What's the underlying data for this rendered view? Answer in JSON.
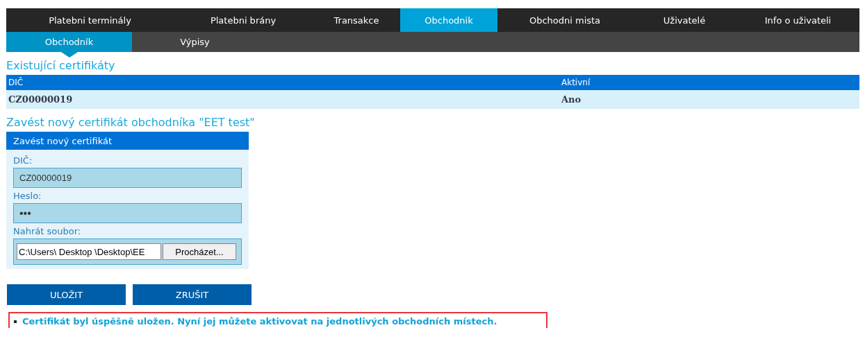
{
  "main_nav": [
    {
      "label": "Platebni terminály",
      "selected": false
    },
    {
      "label": "Platebni brány",
      "selected": false
    },
    {
      "label": "Transakce",
      "selected": false
    },
    {
      "label": "Obchodnik",
      "selected": true
    },
    {
      "label": "Obchodni mista",
      "selected": false
    },
    {
      "label": "Uživatelé",
      "selected": false
    },
    {
      "label": "Info o uživateli",
      "selected": false
    }
  ],
  "sub_nav": [
    {
      "label": "Obchodník",
      "selected": true
    },
    {
      "label": "Výpisy",
      "selected": false
    }
  ],
  "certificates": {
    "title": "Existující certifikáty",
    "columns": [
      "DIČ",
      "Aktivní"
    ],
    "rows": [
      [
        "CZ00000019",
        "Ano"
      ]
    ]
  },
  "new_certificate": {
    "title": "Zavést nový certifikát obchodníka \"EET test\"",
    "panel_title": "Zavést nový certifikát",
    "fields": [
      {
        "kind": "text",
        "label": "DIČ:",
        "value": "CZ00000019"
      },
      {
        "kind": "password",
        "label": "Heslo:",
        "value": "•••"
      },
      {
        "kind": "file",
        "label": "Nahrát soubor:",
        "value": "C:\\Users\\ Desktop \\Desktop\\EE",
        "button": "Procházet..."
      }
    ]
  },
  "buttons": [
    "ULOŽIT",
    "ZRUŠIT"
  ],
  "messages": [
    "Certifikát byl úspěšně uložen. Nyní jej můžete aktivovat na jednotlivých obchodních místech."
  ]
}
